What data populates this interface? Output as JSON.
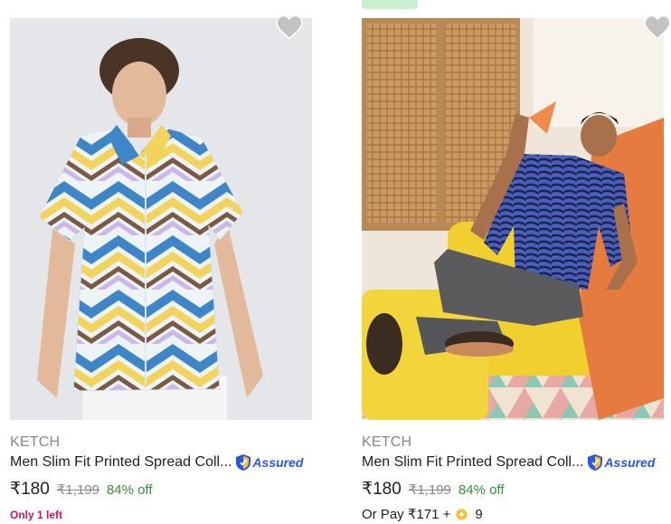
{
  "products": [
    {
      "brand": "KETCH",
      "title": "Men Slim Fit Printed Spread Coll...",
      "assured_label": "Assured",
      "price": "₹180",
      "mrp": "₹1,199",
      "discount": "84% off",
      "stock_note": "Only 1 left",
      "image_icon": "product-photo-printed-shirt",
      "wishlist_icon": "heart-icon"
    },
    {
      "brand": "KETCH",
      "title": "Men Slim Fit Printed Spread Coll...",
      "assured_label": "Assured",
      "price": "₹180",
      "mrp": "₹1,199",
      "discount": "84% off",
      "pay_prefix": "Or Pay ₹171 +",
      "coins": "9",
      "image_icon": "product-photo-zebra-shirt",
      "wishlist_icon": "heart-icon"
    }
  ],
  "colors": {
    "brand_grey": "#878787",
    "discount_green": "#388e3c",
    "stock_pink": "#c2185b",
    "assured_blue": "#2a55e5"
  }
}
